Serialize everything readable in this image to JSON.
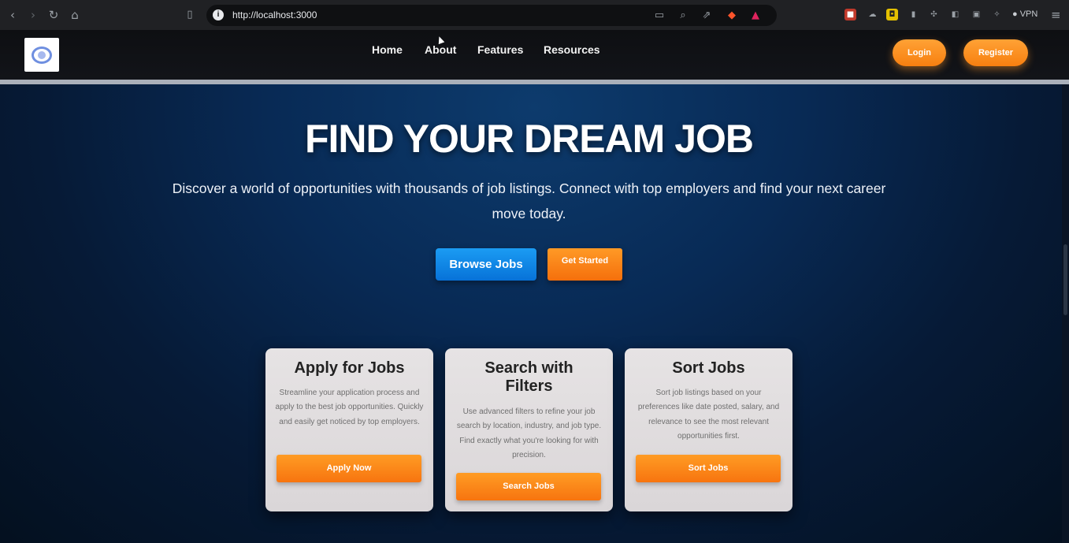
{
  "browser": {
    "url": "http://localhost:3000",
    "vpn_label": "VPN",
    "icons": [
      "back-icon",
      "forward-icon",
      "reload-icon",
      "home-icon",
      "bookmark-icon",
      "info-icon",
      "cast-icon",
      "zoom-icon",
      "share-icon",
      "brave-shield-icon",
      "rewards-icon",
      "extension-icon",
      "puzzle-icon",
      "sidebar-icon",
      "wallet-icon",
      "menu-icon"
    ]
  },
  "header": {
    "nav": [
      "Home",
      "About",
      "Features",
      "Resources"
    ],
    "login_label": "Login",
    "register_label": "Register"
  },
  "hero": {
    "title": "FIND YOUR DREAM JOB",
    "subtitle": "Discover a world of opportunities with thousands of job listings. Connect with top employers and find your next career move today.",
    "browse_label": "Browse Jobs",
    "start_label": "Get Started"
  },
  "cards": [
    {
      "title": "Apply for Jobs",
      "text": "Streamline your application process and apply to the best job opportunities. Quickly and easily get noticed by top employers.",
      "button": "Apply Now"
    },
    {
      "title": "Search with Filters",
      "text": "Use advanced filters to refine your job search by location, industry, and job type. Find exactly what you're looking for with precision.",
      "button": "Search Jobs"
    },
    {
      "title": "Sort Jobs",
      "text": "Sort job listings based on your preferences like date posted, salary, and relevance to see the most relevant opportunities first.",
      "button": "Sort Jobs"
    }
  ],
  "colors": {
    "accent_orange": "#f7820f",
    "accent_blue": "#0d86e6",
    "hero_bg": "#082a55"
  }
}
